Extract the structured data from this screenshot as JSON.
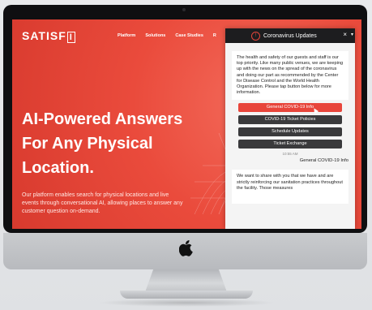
{
  "site": {
    "logo": "SATISF",
    "logo_box": "I",
    "nav": [
      "Platform",
      "Solutions",
      "Case Studies",
      "R"
    ],
    "hero_title": "AI-Powered Answers For Any Physical Location.",
    "hero_sub": "Our platform enables search for physical locations and live events through conversational AI, allowing places to answer any customer question on-demand."
  },
  "chat": {
    "title": "Coronavirus Updates",
    "close": "×",
    "intro": "The health and safety of our guests and staff is our top priority. Like many public venues, we are keeping up with the news on the spread of the coronavirus and doing our part as recommended by the Center for Disease Control and the World Health Organization. Please tap button below for more information.",
    "buttons": [
      "General COVID-19 Info",
      "COVID-19 Ticket Policies",
      "Schedule Updates",
      "Ticket Exchange"
    ],
    "time": "10:55 AM",
    "user_reply": "General COVID-19 Info",
    "reply": "We want to share with you that we have and are strictly reinforcing our sanitation practices throughout the facility. Those measures"
  },
  "colors": {
    "brand_red": "#e8453b",
    "dark": "#1d1d1f"
  }
}
